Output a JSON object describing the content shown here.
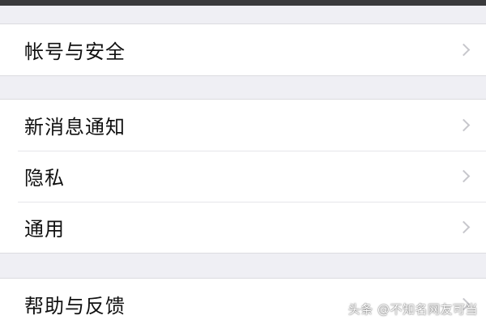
{
  "groups": [
    {
      "items": [
        {
          "label": "帐号与安全"
        }
      ]
    },
    {
      "items": [
        {
          "label": "新消息通知"
        },
        {
          "label": "隐私"
        },
        {
          "label": "通用"
        }
      ]
    },
    {
      "items": [
        {
          "label": "帮助与反馈"
        }
      ]
    }
  ],
  "watermark": "头条 @不知名网友可当",
  "icons": {
    "row_chevron": "chevron-right-icon"
  },
  "colors": {
    "background": "#efeff4",
    "cell": "#ffffff",
    "chevron": "#c7c7cc"
  }
}
